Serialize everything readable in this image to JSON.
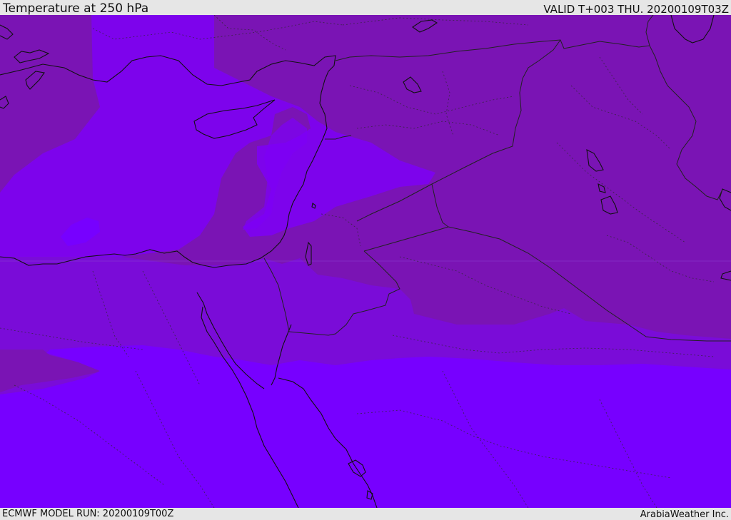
{
  "header": {
    "title": "Temperature at 250 hPa",
    "valid_time": "VALID T+003 THU. 20200109T03Z"
  },
  "footer": {
    "model_run": "ECMWF MODEL RUN: 20200109T00Z",
    "credit": "ArabiaWeather Inc."
  },
  "map": {
    "palette": {
      "dark": "#7a14b4",
      "mid": "#7a0cd8",
      "light": "#7e00f6",
      "bright": "#7700ff",
      "coast": "#111111",
      "border": "#222222"
    }
  }
}
